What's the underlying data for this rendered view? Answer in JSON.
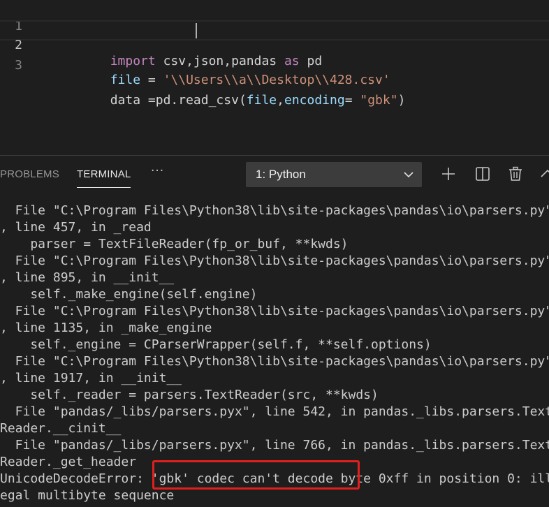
{
  "editor": {
    "lines": [
      {
        "number": "1",
        "tokens": [
          {
            "text": "import",
            "kind": "kw"
          },
          {
            "text": " csv,json,pandas ",
            "kind": "def"
          },
          {
            "text": "as",
            "kind": "kw"
          },
          {
            "text": " pd",
            "kind": "def"
          }
        ]
      },
      {
        "number": "2",
        "tokens": [
          {
            "text": "file",
            "kind": "id"
          },
          {
            "text": " = ",
            "kind": "def"
          },
          {
            "text": "'\\\\Users\\\\a\\\\Desktop\\\\428.csv'",
            "kind": "str"
          }
        ]
      },
      {
        "number": "3",
        "tokens": [
          {
            "text": "data",
            "kind": "def"
          },
          {
            "text": " =pd.read_csv(",
            "kind": "def"
          },
          {
            "text": "file",
            "kind": "id"
          },
          {
            "text": ",",
            "kind": "def"
          },
          {
            "text": "encoding",
            "kind": "id"
          },
          {
            "text": "= ",
            "kind": "def"
          },
          {
            "text": "\"gbk\"",
            "kind": "str"
          },
          {
            "text": ")",
            "kind": "def"
          }
        ]
      }
    ],
    "colors": {
      "keyword": "#c586c0",
      "identifier": "#9cdcfe",
      "string": "#ce9178",
      "default": "#d4d4d4",
      "line_number": "#858585"
    }
  },
  "panel": {
    "tabs": {
      "problems": "PROBLEMS",
      "terminal": "TERMINAL",
      "more": "···"
    },
    "terminal_select": {
      "selected": "1: Python"
    },
    "toolbar_icons": [
      "plus-icon",
      "split-icon",
      "trash-icon",
      "chevron-up-icon"
    ]
  },
  "terminal": {
    "lines": [
      "  File \"C:\\Program Files\\Python38\\lib\\site-packages\\pandas\\io\\parsers.py\"",
      ", line 457, in _read",
      "    parser = TextFileReader(fp_or_buf, **kwds)",
      "  File \"C:\\Program Files\\Python38\\lib\\site-packages\\pandas\\io\\parsers.py\"",
      ", line 895, in __init__",
      "    self._make_engine(self.engine)",
      "  File \"C:\\Program Files\\Python38\\lib\\site-packages\\pandas\\io\\parsers.py\"",
      ", line 1135, in _make_engine",
      "    self._engine = CParserWrapper(self.f, **self.options)",
      "  File \"C:\\Program Files\\Python38\\lib\\site-packages\\pandas\\io\\parsers.py\"",
      ", line 1917, in __init__",
      "    self._reader = parsers.TextReader(src, **kwds)",
      "  File \"pandas/_libs/parsers.pyx\", line 542, in pandas._libs.parsers.Text",
      "Reader.__cinit__",
      "  File \"pandas/_libs/parsers.pyx\", line 766, in pandas._libs.parsers.Text",
      "Reader._get_header",
      "UnicodeDecodeError: 'gbk' codec can't decode byte 0xff in position 0: ill",
      "egal multibyte sequence"
    ],
    "text_color": "#cccccc",
    "highlight_color": "#e0201d"
  }
}
